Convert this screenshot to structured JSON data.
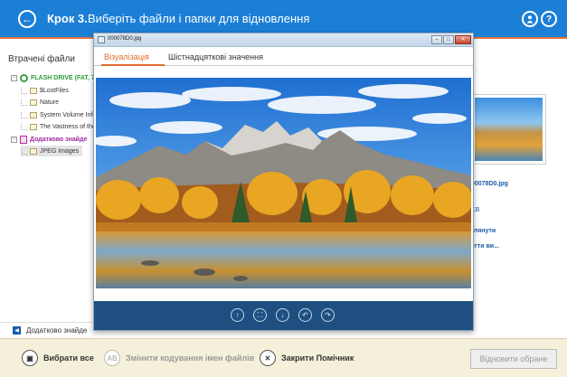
{
  "header": {
    "step_label": "Крок 3.",
    "step_title": "Виберіть файли і папки для відновлення",
    "back_icon": "arrow-left-icon",
    "user_icon": "user-icon",
    "help_label": "?"
  },
  "left_panel": {
    "title": "Втрачені файли",
    "tree": [
      {
        "label": "FLASH DRIVE (FAT, 7",
        "type": "drive"
      },
      {
        "label": "$LostFiles",
        "type": "folder"
      },
      {
        "label": "Nature",
        "type": "folder"
      },
      {
        "label": "System Volume Infor",
        "type": "folder"
      },
      {
        "label": "The Vastness of the",
        "type": "folder"
      },
      {
        "label": "Додатково знайде",
        "type": "extra"
      },
      {
        "label": "JPEG Images",
        "type": "folder"
      }
    ],
    "bottom_label": "Додатково знайде"
  },
  "right_panel": {
    "filename": "00078D0.jpg",
    "lines": [
      "KB",
      "глянути",
      "егти ви..."
    ]
  },
  "preview": {
    "window_title": "000078D0.jpg",
    "tabs": [
      "Візуалізація",
      "Шістнадцяткові значення"
    ],
    "tools": [
      "arrow-up-icon",
      "fit-icon",
      "arrow-down-icon",
      "rotate-left-icon",
      "rotate-right-icon"
    ]
  },
  "bottom_bar": {
    "select_all": "Вибрати все",
    "change_encoding": "Змінити кодування імен файлів",
    "close_wizard": "Закрити Помічник",
    "restore_selected": "Відновити обране",
    "encoding_icon_text": "AB"
  },
  "colors": {
    "header_bg": "#1c7fd6",
    "accent_orange": "#e8733a",
    "toolbar_bg": "#1e4f80",
    "drive_green": "#2a9d3a",
    "extra_purple": "#9c2a9c"
  }
}
